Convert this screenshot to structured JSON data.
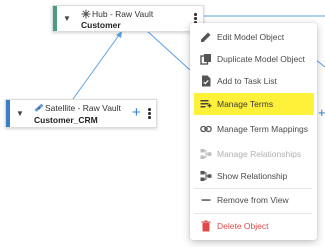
{
  "colors": {
    "hub_accent": "#4a9d84",
    "satellite_accent": "#3b7ec8",
    "link": "#5aa0e6",
    "highlight": "#fff13a",
    "danger": "#e24a4a"
  },
  "hub": {
    "type": "Hub - Raw Vault",
    "name": "Customer",
    "icon": "hub-star-icon"
  },
  "satellite": {
    "type": "Satellite - Raw Vault",
    "name": "Customer_CRM",
    "icon": "satellite-icon",
    "add_label": "+"
  },
  "partial_node": {
    "add_label": "+"
  },
  "context_menu": {
    "items": [
      {
        "label": "Edit Model Object",
        "icon": "pencil-icon",
        "state": "enabled"
      },
      {
        "label": "Duplicate Model Object",
        "icon": "copy-icon",
        "state": "enabled"
      },
      {
        "label": "Add to Task List",
        "icon": "task-icon",
        "state": "enabled"
      },
      {
        "label": "Manage Terms",
        "icon": "terms-icon",
        "state": "highlighted"
      },
      {
        "label": "Manage Term Mappings",
        "icon": "link-icon",
        "state": "enabled"
      },
      {
        "label": "Manage Relationships",
        "icon": "relationships-icon",
        "state": "disabled"
      },
      {
        "label": "Show Relationship",
        "icon": "show-relationship-icon",
        "state": "enabled"
      },
      {
        "label": "Remove from View",
        "icon": "minus-icon",
        "state": "enabled"
      },
      {
        "label": "Delete Object",
        "icon": "trash-icon",
        "state": "danger"
      }
    ]
  }
}
